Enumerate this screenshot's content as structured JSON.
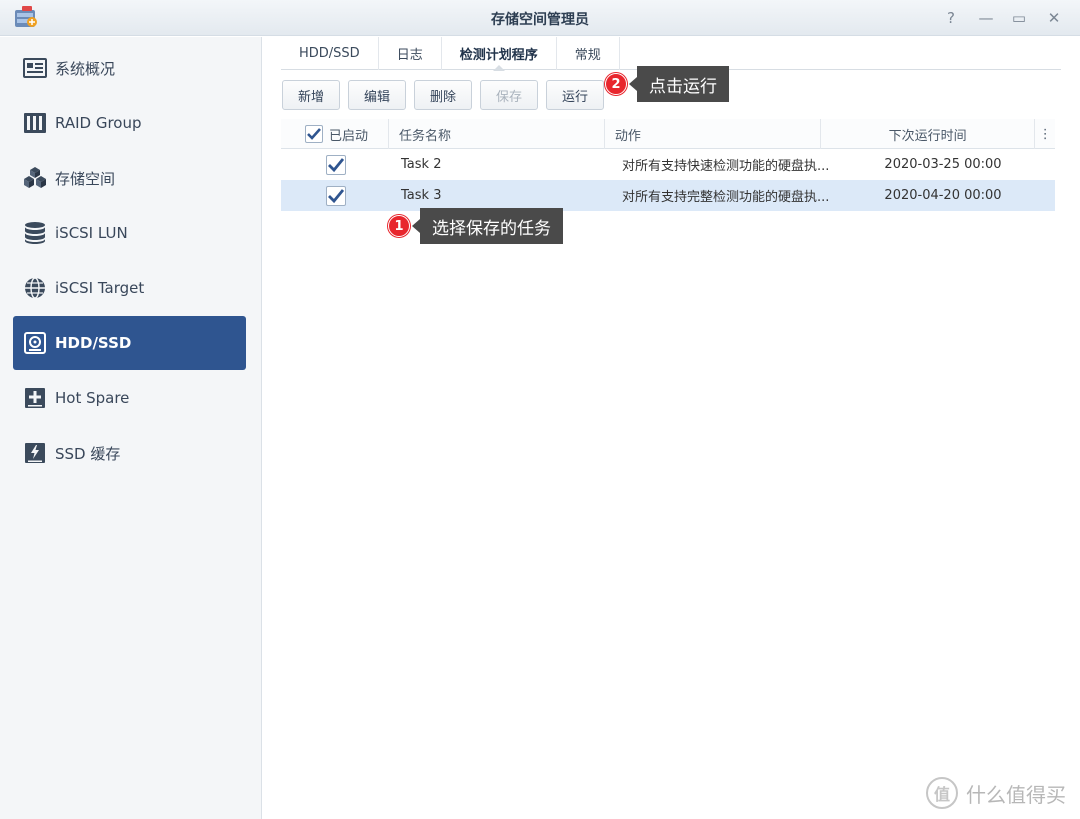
{
  "window": {
    "title": "存储空间管理员",
    "help": "?",
    "minimize": "—",
    "maximize": "▭",
    "close": "✕"
  },
  "sidebar": {
    "items": [
      {
        "label": "系统概况",
        "icon": "overview-icon"
      },
      {
        "label": "RAID Group",
        "icon": "raid-icon"
      },
      {
        "label": "存储空间",
        "icon": "storage-cubes-icon"
      },
      {
        "label": "iSCSI LUN",
        "icon": "database-icon"
      },
      {
        "label": "iSCSI Target",
        "icon": "globe-icon"
      },
      {
        "label": "HDD/SSD",
        "icon": "hdd-icon"
      },
      {
        "label": "Hot Spare",
        "icon": "hot-spare-icon"
      },
      {
        "label": "SSD 缓存",
        "icon": "ssd-cache-icon"
      }
    ],
    "active_index": 5
  },
  "tabs": [
    {
      "label": "HDD/SSD"
    },
    {
      "label": "日志"
    },
    {
      "label": "检测计划程序"
    },
    {
      "label": "常规"
    }
  ],
  "toolbar": {
    "create": "新增",
    "edit": "编辑",
    "delete": "删除",
    "save": "保存",
    "run": "运行"
  },
  "table": {
    "headers": {
      "enabled": "已启动",
      "task_name": "任务名称",
      "action": "动作",
      "next_run": "下次运行时间",
      "menu": "⋮"
    },
    "rows": [
      {
        "enabled": true,
        "task_name": "Task 2",
        "action": "对所有支持快速检测功能的硬盘执...",
        "next_run": "2020-03-25 00:00"
      },
      {
        "enabled": true,
        "task_name": "Task 3",
        "action": "对所有支持完整检测功能的硬盘执...",
        "next_run": "2020-04-20 00:00"
      }
    ]
  },
  "callouts": {
    "step1": {
      "number": "1",
      "text": "选择保存的任务"
    },
    "step2": {
      "number": "2",
      "text": "点击运行"
    }
  },
  "watermark": {
    "logo": "值",
    "text": "什么值得买"
  },
  "colors": {
    "accent": "#2f5590",
    "selected_row": "#dce9f8",
    "badge": "#e8262d",
    "bubble": "#4a4a4a"
  }
}
